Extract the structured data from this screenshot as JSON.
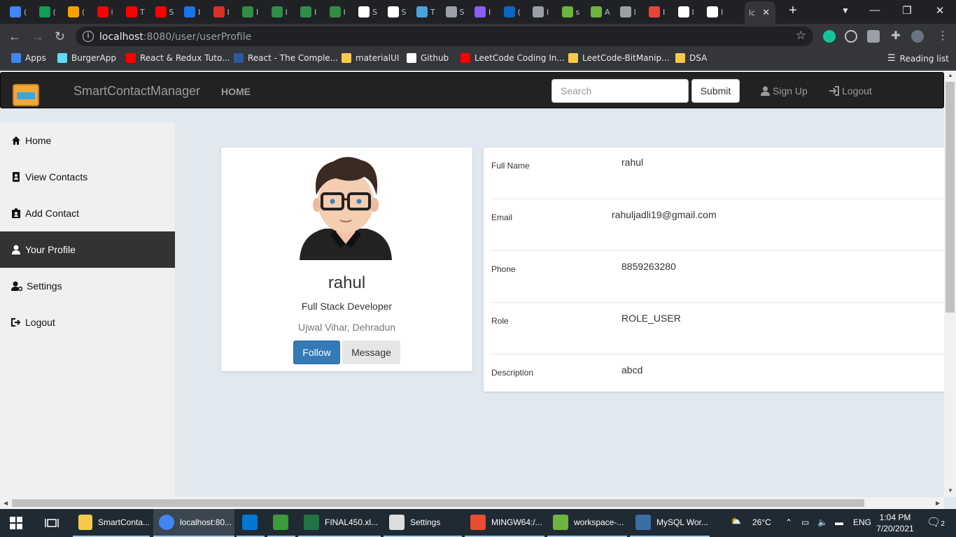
{
  "browser": {
    "tabs": [
      {
        "letter": "(",
        "color": "#4285f4"
      },
      {
        "letter": "(",
        "color": "#0f9d58"
      },
      {
        "letter": "(",
        "color": "#f4a100"
      },
      {
        "letter": "i",
        "color": "#ff0000"
      },
      {
        "letter": "T",
        "color": "#ff0000"
      },
      {
        "letter": "S",
        "color": "#ff0000"
      },
      {
        "letter": "I",
        "color": "#1a73e8"
      },
      {
        "letter": "I",
        "color": "#d93025"
      },
      {
        "letter": "I",
        "color": "#2f8d46"
      },
      {
        "letter": "I",
        "color": "#2f8d46"
      },
      {
        "letter": "I",
        "color": "#2f8d46"
      },
      {
        "letter": "I",
        "color": "#2f8d46"
      },
      {
        "letter": "S",
        "color": "#ffffff"
      },
      {
        "letter": "S",
        "color": "#ffffff"
      },
      {
        "letter": "T",
        "color": "#4aa3df"
      },
      {
        "letter": "S",
        "color": "#9aa0a6"
      },
      {
        "letter": "I",
        "color": "#8b5cf6"
      },
      {
        "letter": "(",
        "color": "#0a66c2"
      },
      {
        "letter": "I",
        "color": "#9aa0a6"
      },
      {
        "letter": "s",
        "color": "#6db33f"
      },
      {
        "letter": "A",
        "color": "#6db33f"
      },
      {
        "letter": "I",
        "color": "#9aa0a6"
      },
      {
        "letter": "I",
        "color": "#ea4335"
      },
      {
        "letter": "I",
        "color": "#ffffff"
      },
      {
        "letter": "I",
        "color": "#ffffff"
      }
    ],
    "active_tab_letter": "lc",
    "url_host": "localhost",
    "url_rest": ":8080/user/userProfile",
    "bookmarks": [
      {
        "label": "Apps",
        "color": "#4285f4"
      },
      {
        "label": "BurgerApp",
        "color": "#61dafb"
      },
      {
        "label": "React & Redux Tuto...",
        "color": "#ff0000"
      },
      {
        "label": "React - The Comple...",
        "color": "#2c5aa0"
      },
      {
        "label": "materialUI",
        "color": "#f6c94c"
      },
      {
        "label": "Github",
        "color": "#ffffff"
      },
      {
        "label": "LeetCode Coding In...",
        "color": "#ff0000"
      },
      {
        "label": "LeetCode-BitManip...",
        "color": "#f6c94c"
      },
      {
        "label": "DSA",
        "color": "#f6c94c"
      }
    ],
    "reading_list": "Reading list"
  },
  "navbar": {
    "brand": "SmartContactManager",
    "home": "HOME",
    "search_placeholder": "Search",
    "submit": "Submit",
    "signup": "Sign Up",
    "logout": "Logout"
  },
  "sidebar": {
    "items": [
      {
        "label": "Home",
        "icon": "home-icon"
      },
      {
        "label": "View Contacts",
        "icon": "address-book-icon"
      },
      {
        "label": "Add Contact",
        "icon": "add-contact-icon"
      },
      {
        "label": "Your Profile",
        "icon": "user-icon"
      },
      {
        "label": "Settings",
        "icon": "user-cog-icon"
      },
      {
        "label": "Logout",
        "icon": "sign-out-icon"
      }
    ]
  },
  "profile": {
    "name": "rahul",
    "title": "Full Stack Developer",
    "location": "Ujwal Vihar, Dehradun",
    "follow": "Follow",
    "message": "Message"
  },
  "details": {
    "rows": [
      {
        "label": "Full Name",
        "value": "rahul"
      },
      {
        "label": "Email",
        "value": "rahuljadli19@gmail.com"
      },
      {
        "label": "Phone",
        "value": "8859263280"
      },
      {
        "label": "Role",
        "value": "ROLE_USER"
      },
      {
        "label": "Description",
        "value": "abcd"
      }
    ]
  },
  "taskbar": {
    "items": [
      {
        "label": "SmartConta...",
        "color": "#f6c94c"
      },
      {
        "label": "localhost:80...",
        "color": "#4285f4"
      },
      {
        "label": "",
        "color": "#0078d4"
      },
      {
        "label": "",
        "color": "#3a9b3a"
      },
      {
        "label": "FINAL450.xl...",
        "color": "#217346"
      },
      {
        "label": "Settings",
        "color": "#dddddd"
      },
      {
        "label": "MINGW64:/...",
        "color": "#e84e31"
      },
      {
        "label": "workspace-...",
        "color": "#6db33f"
      },
      {
        "label": "MySQL Wor...",
        "color": "#3b6ea5"
      }
    ],
    "weather": "26°C",
    "lang": "ENG",
    "time": "1:04 PM",
    "date": "7/20/2021",
    "notifications": "2"
  }
}
